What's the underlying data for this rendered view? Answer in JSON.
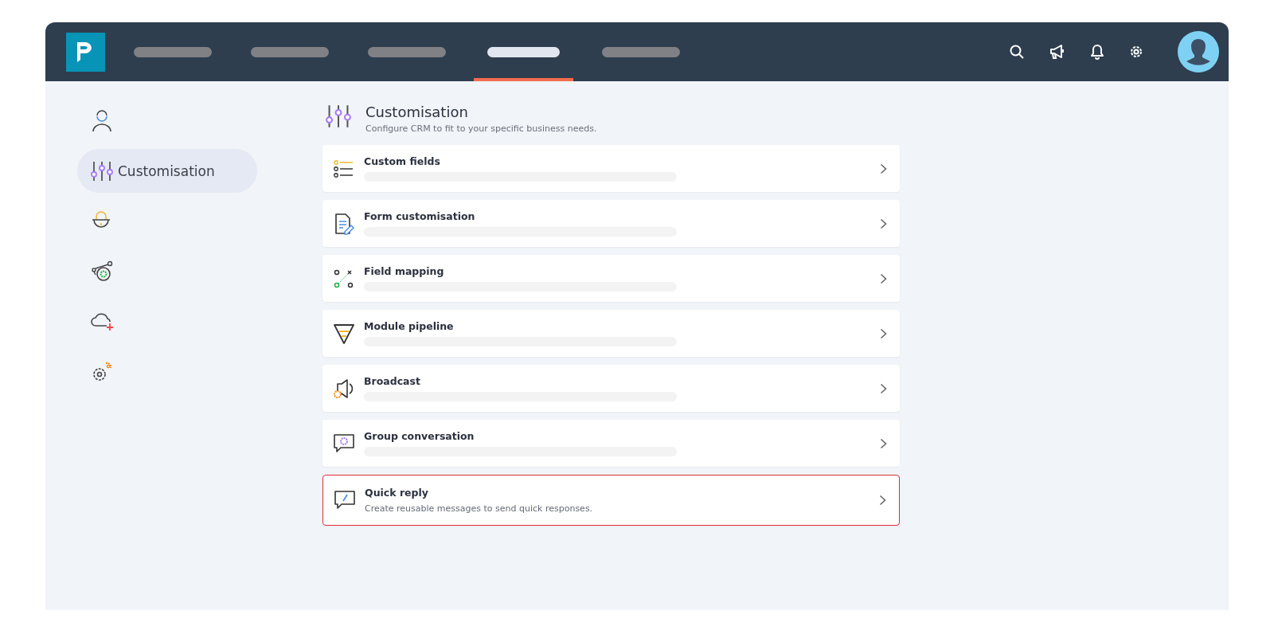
{
  "header": {
    "nav_tabs": [
      {
        "selected": false
      },
      {
        "selected": false
      },
      {
        "selected": false
      },
      {
        "selected": true
      },
      {
        "selected": false
      }
    ]
  },
  "sidebar": {
    "items": [
      {
        "kind": "user",
        "selected": false
      },
      {
        "kind": "sliders",
        "selected": true,
        "label": "Customisation"
      },
      {
        "kind": "lock",
        "selected": false
      },
      {
        "kind": "gear-link",
        "selected": false
      },
      {
        "kind": "cloud-plus",
        "selected": false
      },
      {
        "kind": "gears",
        "selected": false
      }
    ]
  },
  "page": {
    "title": "Customisation",
    "subtitle": "Configure CRM to fit to your specific business needs.",
    "cards": [
      {
        "kind": "list",
        "title": "Custom fields",
        "redacted": true,
        "highlighted": false
      },
      {
        "kind": "form",
        "title": "Form customisation",
        "redacted": true,
        "highlighted": false
      },
      {
        "kind": "mapping",
        "title": "Field mapping",
        "redacted": true,
        "highlighted": false
      },
      {
        "kind": "funnel",
        "title": "Module pipeline",
        "redacted": true,
        "highlighted": false
      },
      {
        "kind": "broadcast",
        "title": "Broadcast",
        "redacted": true,
        "highlighted": false
      },
      {
        "kind": "chat-gear",
        "title": "Group conversation",
        "redacted": true,
        "highlighted": false
      },
      {
        "kind": "chat-pen",
        "title": "Quick reply",
        "description": "Create reusable messages to send quick responses.",
        "highlighted": true
      }
    ]
  }
}
